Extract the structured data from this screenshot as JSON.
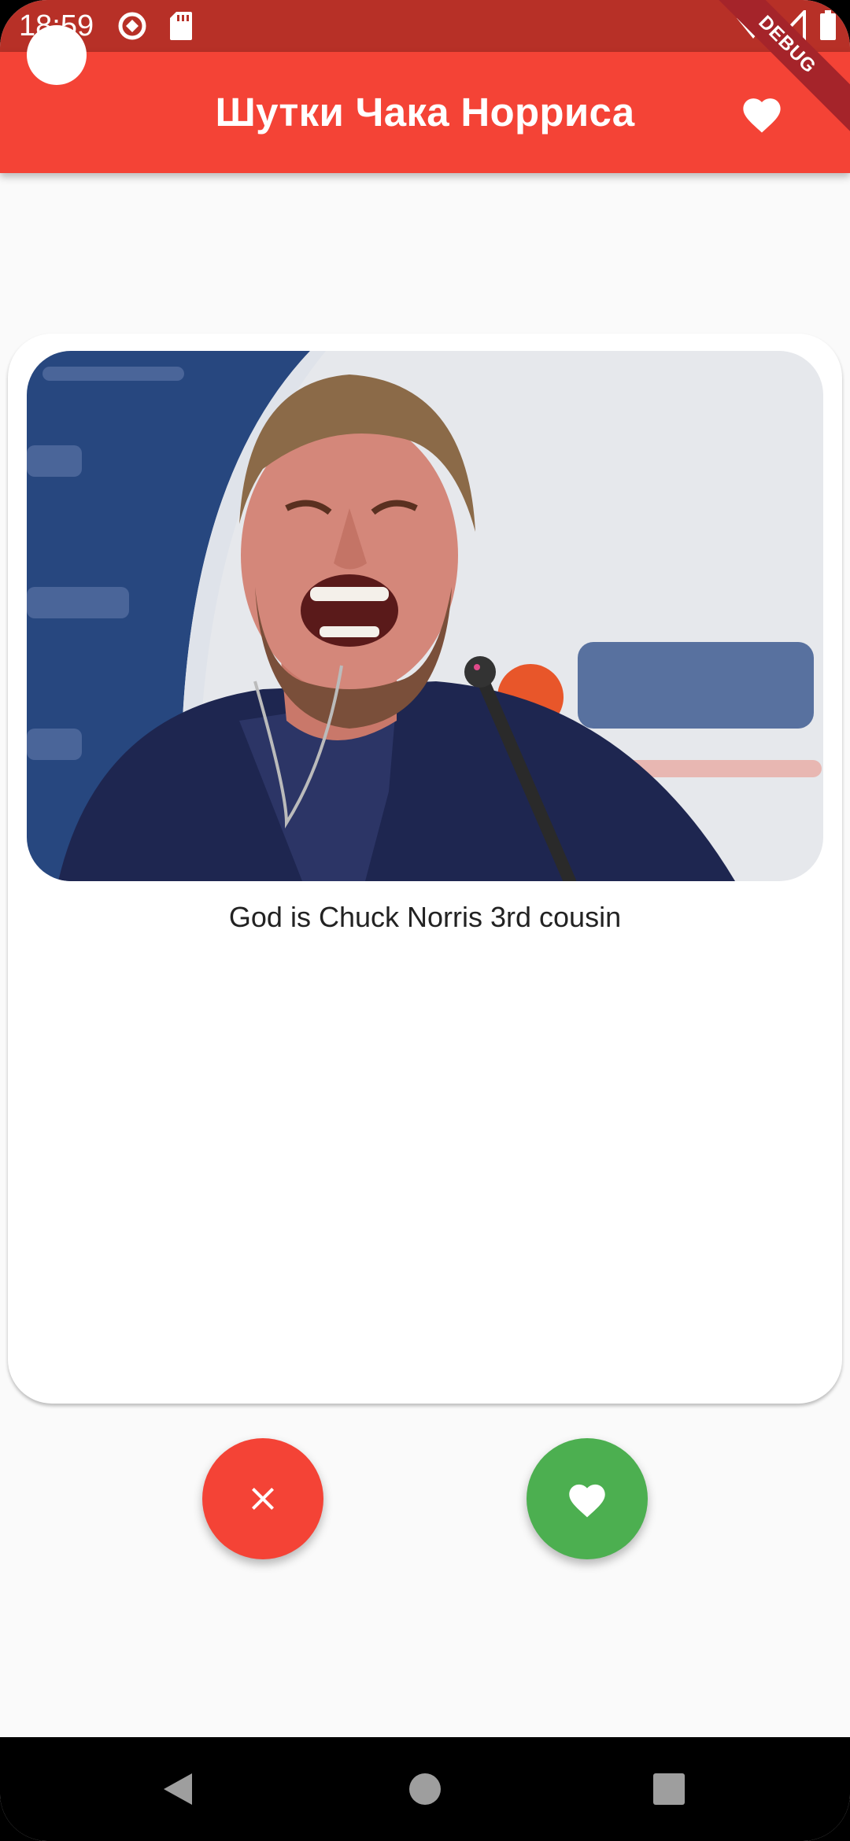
{
  "status_bar": {
    "time": "18:59",
    "icons": [
      "at-sign-icon",
      "sd-card-icon",
      "wifi-icon",
      "signal-icon",
      "battery-icon"
    ],
    "color": "#b73027"
  },
  "debug_banner": {
    "label": "DEBUG"
  },
  "app_bar": {
    "title": "Шутки Чака Норриса",
    "favorites_icon": "heart-icon",
    "color": "#f44336"
  },
  "card": {
    "image_icon": "photo-icon",
    "joke": "God is Chuck Norris 3rd cousin"
  },
  "actions": {
    "dislike": {
      "icon": "close-icon",
      "color": "#f44336"
    },
    "like": {
      "icon": "heart-icon",
      "color": "#4caf50"
    }
  },
  "nav_bar": {
    "items": [
      "back-icon",
      "home-icon",
      "recents-icon"
    ]
  }
}
